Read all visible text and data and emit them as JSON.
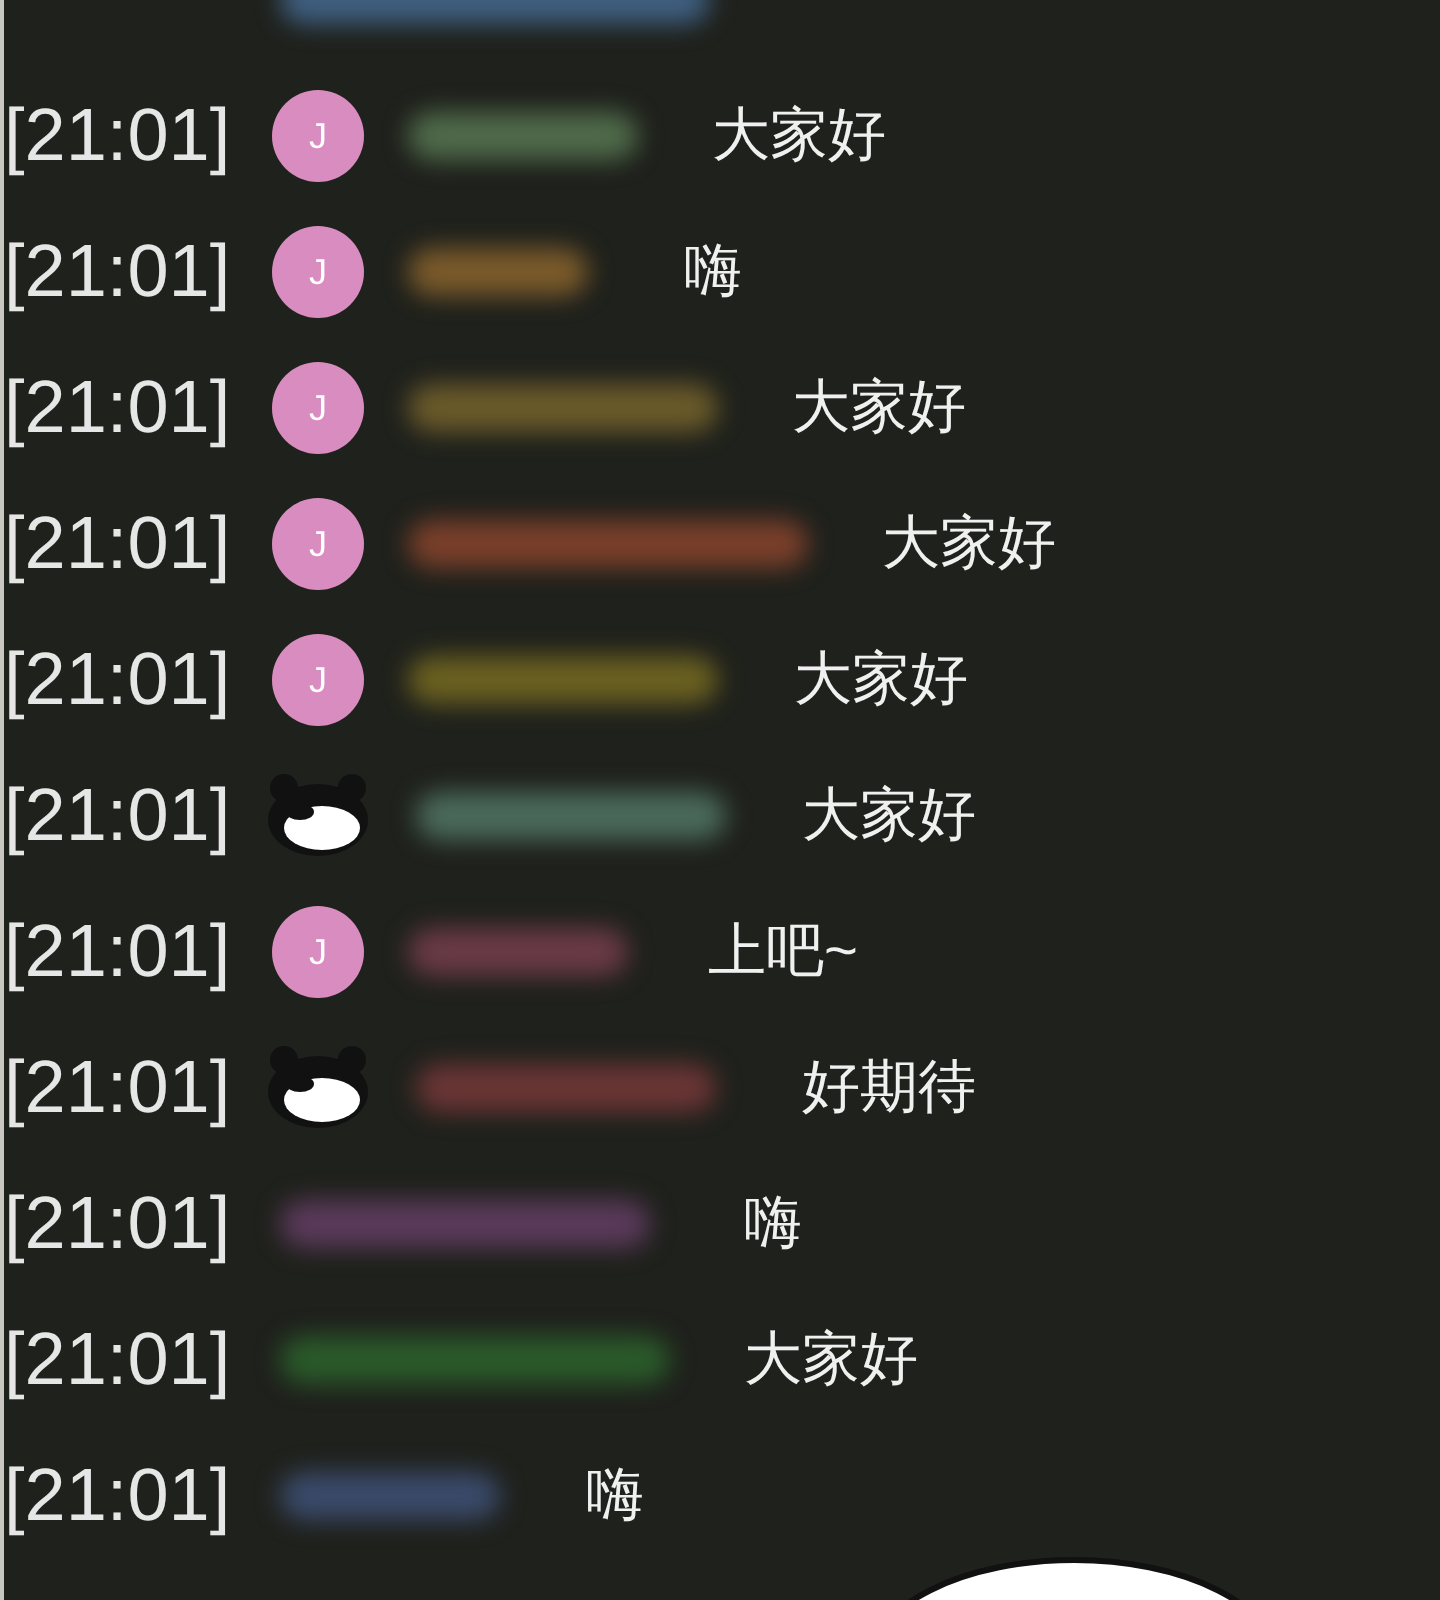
{
  "messages": [
    {
      "kind": "none",
      "color": "#3f5f80"
    },
    {
      "time": "[21:01]",
      "kind": "letter",
      "avatar_letter": "J",
      "color": "#4f6a4a",
      "text": "大家好"
    },
    {
      "time": "[21:01]",
      "kind": "letter",
      "avatar_letter": "J",
      "color": "#7a5a2a",
      "text": "嗨"
    },
    {
      "time": "[21:01]",
      "kind": "letter",
      "avatar_letter": "J",
      "color": "#6a5a2a",
      "text": "大家好"
    },
    {
      "time": "[21:01]",
      "kind": "letter",
      "avatar_letter": "J",
      "color": "#7a3f2a",
      "text": "大家好"
    },
    {
      "time": "[21:01]",
      "kind": "letter",
      "avatar_letter": "J",
      "color": "#6a6020",
      "text": "大家好"
    },
    {
      "time": "[21:01]",
      "kind": "panda",
      "color": "#4a6a5a",
      "text": "大家好"
    },
    {
      "time": "[21:01]",
      "kind": "letter",
      "avatar_letter": "J",
      "color": "#6a3a45",
      "text": "上吧~"
    },
    {
      "time": "[21:01]",
      "kind": "panda",
      "color": "#6a3535",
      "text": "好期待"
    },
    {
      "time": "[21:01]",
      "kind": "none",
      "color": "#5a3a5a",
      "text": "嗨"
    },
    {
      "time": "[21:01]",
      "kind": "none",
      "color": "#2a5a2a",
      "text": "大家好"
    },
    {
      "time": "[21:01]",
      "kind": "none",
      "color": "#3a4a6a",
      "text": "嗨"
    }
  ]
}
